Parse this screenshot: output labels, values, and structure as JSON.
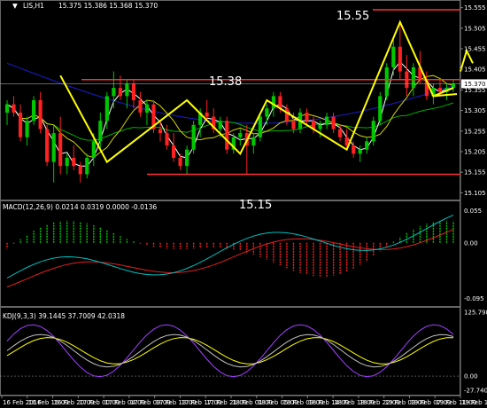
{
  "header": {
    "symbol": "LIS,H1",
    "quote": "15.375 15.386 15.368 15.370"
  },
  "macd_header": "MACD(12,26,9) 0.0214 0.0319 0.0000 -0.0136",
  "kdj_header": "KDJ(9,3,3) 39.1445 37.7009 42.0318",
  "annotations": {
    "level_high": "15.55",
    "level_mid": "15.38",
    "level_low": "15.15"
  },
  "colors": {
    "background": "#000000",
    "bull": "#00c800",
    "bear": "#ff2020",
    "level_line": "#ff3030",
    "zigzag": "#ffff00",
    "ma_fast": "#ffffff",
    "ma_yellow": "#d4d400",
    "ma_green": "#00b000",
    "ma_blue": "#1818b0",
    "macd_line": "#00c0c0",
    "signal_line": "#e02020",
    "k_line": "#c0c0c0",
    "d_line": "#ffff00",
    "j_line": "#a040ff"
  },
  "chart_data": [
    {
      "type": "candlestick",
      "panel": "price",
      "y_ticks": [
        "15.555",
        "15.505",
        "15.455",
        "15.405",
        "15.355",
        "15.305",
        "15.255",
        "15.205",
        "15.155",
        "15.105"
      ],
      "ylim": [
        15.095,
        15.565
      ],
      "current_price": "15.370",
      "x_ticks": [
        "16 Feb 2016",
        "16 Feb 16:00",
        "16 Feb 20:00",
        "17 Feb 00:00",
        "17 Feb 04:00",
        "17 Feb 09:00",
        "17 Feb 13:00",
        "17 Feb 17:00",
        "17 Feb 21:00",
        "18 Feb 01:00",
        "18 Feb 05:00",
        "18 Feb 09:00",
        "18 Feb 14:00",
        "18 Feb 18:00",
        "18 Feb 22:00",
        "19 Feb 03:00",
        "19 Feb 07:00",
        "19 Feb 11:00",
        "19 Feb 15:00"
      ],
      "levels": [
        15.55,
        15.38,
        15.15
      ],
      "candles": [
        [
          15.3,
          15.33,
          15.27,
          15.32
        ],
        [
          15.32,
          15.34,
          15.29,
          15.3
        ],
        [
          15.3,
          15.32,
          15.23,
          15.24
        ],
        [
          15.24,
          15.29,
          15.22,
          15.28
        ],
        [
          15.28,
          15.34,
          15.27,
          15.33
        ],
        [
          15.33,
          15.35,
          15.25,
          15.26
        ],
        [
          15.26,
          15.27,
          15.17,
          15.18
        ],
        [
          15.18,
          15.27,
          15.13,
          15.25
        ],
        [
          15.25,
          15.29,
          15.15,
          15.17
        ],
        [
          15.17,
          15.2,
          15.15,
          15.19
        ],
        [
          15.19,
          15.22,
          15.16,
          15.17
        ],
        [
          15.17,
          15.18,
          15.13,
          15.15
        ],
        [
          15.15,
          15.2,
          15.14,
          15.19
        ],
        [
          15.19,
          15.25,
          15.17,
          15.23
        ],
        [
          15.23,
          15.3,
          15.21,
          15.28
        ],
        [
          15.28,
          15.35,
          15.26,
          15.34
        ],
        [
          15.34,
          15.4,
          15.31,
          15.36
        ],
        [
          15.36,
          15.39,
          15.33,
          15.34
        ],
        [
          15.34,
          15.38,
          15.31,
          15.37
        ],
        [
          15.37,
          15.38,
          15.31,
          15.33
        ],
        [
          15.33,
          15.35,
          15.29,
          15.3
        ],
        [
          15.3,
          15.33,
          15.27,
          15.32
        ],
        [
          15.32,
          15.33,
          15.25,
          15.26
        ],
        [
          15.26,
          15.28,
          15.23,
          15.25
        ],
        [
          15.25,
          15.27,
          15.21,
          15.22
        ],
        [
          15.22,
          15.25,
          15.18,
          15.19
        ],
        [
          15.19,
          15.2,
          15.16,
          15.17
        ],
        [
          15.17,
          15.22,
          15.15,
          15.21
        ],
        [
          15.21,
          15.28,
          15.2,
          15.27
        ],
        [
          15.27,
          15.31,
          15.24,
          15.3
        ],
        [
          15.3,
          15.33,
          15.28,
          15.29
        ],
        [
          15.29,
          15.31,
          15.25,
          15.26
        ],
        [
          15.26,
          15.29,
          15.24,
          15.28
        ],
        [
          15.28,
          15.29,
          15.2,
          15.21
        ],
        [
          15.21,
          15.25,
          15.2,
          15.24
        ],
        [
          15.24,
          15.26,
          15.22,
          15.25
        ],
        [
          15.25,
          15.27,
          15.15,
          15.22
        ],
        [
          15.22,
          15.25,
          15.2,
          15.24
        ],
        [
          15.24,
          15.3,
          15.23,
          15.29
        ],
        [
          15.29,
          15.32,
          15.27,
          15.31
        ],
        [
          15.31,
          15.35,
          15.29,
          15.34
        ],
        [
          15.34,
          15.35,
          15.3,
          15.31
        ],
        [
          15.31,
          15.32,
          15.27,
          15.28
        ],
        [
          15.28,
          15.3,
          15.25,
          15.26
        ],
        [
          15.26,
          15.31,
          15.25,
          15.3
        ],
        [
          15.3,
          15.31,
          15.27,
          15.28
        ],
        [
          15.28,
          15.29,
          15.25,
          15.26
        ],
        [
          15.26,
          15.28,
          15.24,
          15.27
        ],
        [
          15.27,
          15.3,
          15.26,
          15.29
        ],
        [
          15.29,
          15.3,
          15.25,
          15.26
        ],
        [
          15.26,
          15.27,
          15.23,
          15.24
        ],
        [
          15.24,
          15.26,
          15.21,
          15.22
        ],
        [
          15.22,
          15.23,
          15.19,
          15.2
        ],
        [
          15.2,
          15.22,
          15.18,
          15.21
        ],
        [
          15.21,
          15.24,
          15.2,
          15.23
        ],
        [
          15.23,
          15.29,
          15.22,
          15.28
        ],
        [
          15.28,
          15.35,
          15.27,
          15.34
        ],
        [
          15.34,
          15.42,
          15.33,
          15.41
        ],
        [
          15.41,
          15.48,
          15.39,
          15.46
        ],
        [
          15.46,
          15.52,
          15.38,
          15.4
        ],
        [
          15.4,
          15.44,
          15.34,
          15.36
        ],
        [
          15.36,
          15.42,
          15.34,
          15.41
        ],
        [
          15.41,
          15.45,
          15.37,
          15.38
        ],
        [
          15.38,
          15.4,
          15.33,
          15.34
        ],
        [
          15.34,
          15.37,
          15.32,
          15.36
        ],
        [
          15.36,
          15.38,
          15.34,
          15.35
        ],
        [
          15.35,
          15.37,
          15.33,
          15.36
        ],
        [
          15.36,
          15.38,
          15.35,
          15.37
        ]
      ]
    },
    {
      "type": "macd",
      "panel": "macd",
      "y_ticks": [
        "0.055",
        "0.00",
        "-0.095"
      ],
      "ylim": [
        -0.1,
        0.06
      ]
    },
    {
      "type": "kdj",
      "panel": "kdj",
      "y_ticks": [
        "125.798",
        "0.00",
        "-27.7401"
      ],
      "ylim": [
        -27.7401,
        125.798
      ]
    }
  ]
}
